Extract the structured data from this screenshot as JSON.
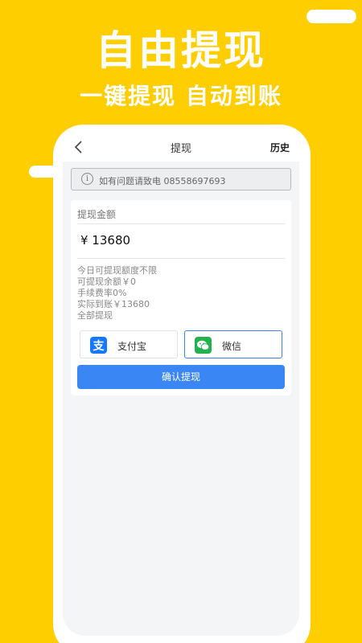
{
  "promo": {
    "headline": "自由提现",
    "subline": "一键提现 自动到账"
  },
  "navbar": {
    "back_icon": "chevron-left-icon",
    "title": "提现",
    "history_label": "历史"
  },
  "notice": {
    "icon": "info-icon",
    "icon_glyph": "i",
    "text": "如有问题请致电 08558697693"
  },
  "withdraw": {
    "amount_label": "提现金额",
    "amount_value": "¥ 13680",
    "info_lines": [
      "今日可提现额度不限",
      "可提现余额￥0",
      "手续费率0%",
      "实际到账￥13680",
      "全部提现"
    ]
  },
  "payment_methods": [
    {
      "label": "支付宝",
      "icon": "alipay-icon",
      "icon_glyph": "支",
      "selected": false
    },
    {
      "label": "微信",
      "icon": "wechat-icon",
      "selected": true
    }
  ],
  "confirm_button": {
    "label": "确认提现"
  },
  "colors": {
    "background": "#FFCE00",
    "accent": "#3A86F4",
    "alipay": "#1677FF",
    "wechat": "#22B14C"
  }
}
